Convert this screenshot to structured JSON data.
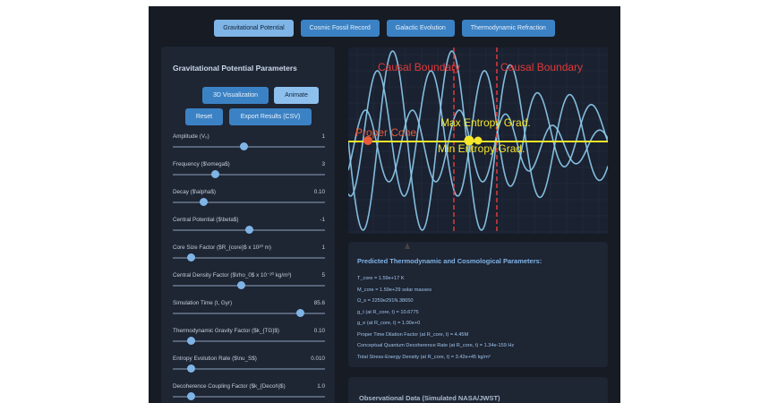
{
  "tabs": [
    {
      "label": "Gravitational Potential",
      "active": true
    },
    {
      "label": "Cosmic Fossil Record",
      "active": false
    },
    {
      "label": "Galactic Evolution",
      "active": false
    },
    {
      "label": "Thermodynamic Refraction",
      "active": false
    }
  ],
  "params": {
    "title": "Gravitational Potential Parameters",
    "buttons": {
      "visualization": "3D Visualization",
      "animate": "Animate",
      "reset": "Reset",
      "export": "Export Results (CSV)"
    },
    "sliders": [
      {
        "label": "Amplitude (V₀)",
        "value": "1",
        "level": 0.47
      },
      {
        "label": "Frequency ($\\omega$)",
        "value": "3",
        "level": 0.28
      },
      {
        "label": "Decay ($\\alpha$)",
        "value": "0.10",
        "level": 0.2
      },
      {
        "label": "Central Potential ($\\beta$)",
        "value": "-1",
        "level": 0.5
      },
      {
        "label": "Core Size Factor ($R_{core}$ x 10²⁰ m)",
        "value": "1",
        "level": 0.12
      },
      {
        "label": "Central Density Factor ($\\rho_0$ x 10⁻²⁰ kg/m³)",
        "value": "5",
        "level": 0.45
      },
      {
        "label": "Simulation Time (t, Gyr)",
        "value": "85.6",
        "level": 0.84
      },
      {
        "label": "Thermodynamic Gravity Factor ($k_{TG}$)",
        "value": "0.10",
        "level": 0.12
      },
      {
        "label": "Entropy Evolution Rate ($\\nu_S$)",
        "value": "0.010",
        "level": 0.12
      },
      {
        "label": "Decoherence Coupling Factor ($k_{Decoh}$)",
        "value": "1.0",
        "level": 0.12
      }
    ]
  },
  "plot": {
    "labels": {
      "causal_left": "Causal Boundary",
      "causal_right": "Causal Boundary",
      "proper_cone": "Proper Cone",
      "max_entropy": "Max Entropy Grad.",
      "min_entropy": "Min Entropy Grad."
    },
    "colors": {
      "wave": "#8ecdf0",
      "boundary": "#e03a3a",
      "entropy": "#f5e62a",
      "cone": "#e85a3a"
    }
  },
  "results": {
    "title": "Predicted Thermodynamic and Cosmological Parameters:",
    "lines": [
      "T_core = 1.59e+17 K",
      "M_core = 1.59e+29 solar masses",
      "Ω_s = 2259e291N.38650",
      "g_t (at R_core, t) = 10.6775",
      "g_e (at R_core, t) = 1.00e+0",
      "Proper Time Dilation Factor (at R_core, t) = 4.45M",
      "Conceptual Quantum Decoherence Rate (at R_core, t) = 1.34e-159 Hz",
      "Total Stress-Energy Density (at R_core, t) = 3.42e+45 kg/m³"
    ]
  },
  "observational": {
    "title": "Observational Data (Simulated NASA/JWST)"
  }
}
